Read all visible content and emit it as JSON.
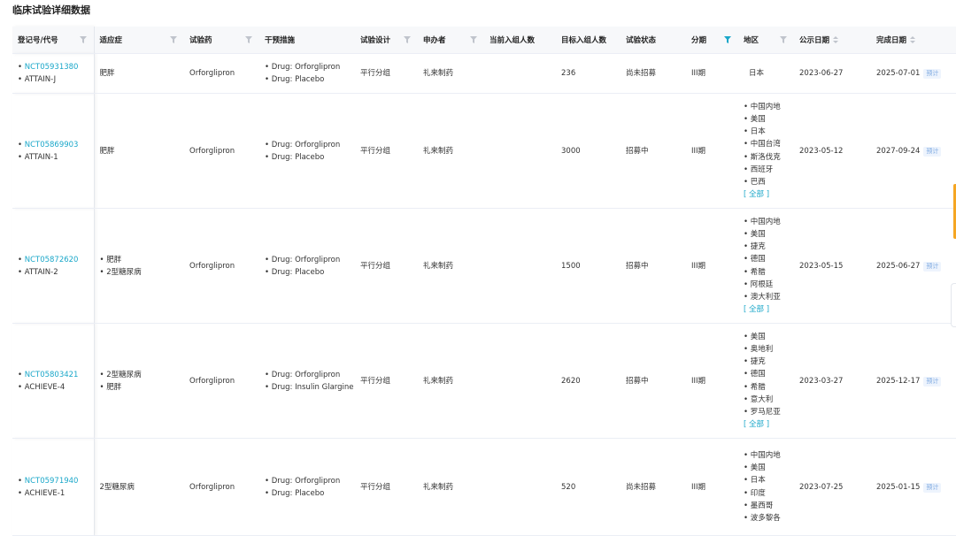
{
  "page": {
    "title": "临床试验详细数据"
  },
  "colors": {
    "link": "#1aa7c9",
    "filter_inactive": "#c0c4cc",
    "filter_active": "#1aa7c9",
    "tag_text": "#7aa7e0",
    "tag_bg": "#eef4fd",
    "side_tab": "#f5a623"
  },
  "table": {
    "columns": {
      "reg_id": "登记号/代号",
      "indication": "适应症",
      "drug": "试验药",
      "intervention": "干预措施",
      "design": "试验设计",
      "sponsor": "申办者",
      "current_enroll": "当前入组人数",
      "target_enroll": "目标入组人数",
      "status": "试验状态",
      "phase": "分期",
      "region": "地区",
      "pub_date": "公示日期",
      "complete_date": "完成日期"
    },
    "rows": [
      {
        "nct": "NCT05931380",
        "code": "ATTAIN-J",
        "indication1": "肥胖",
        "indication2": "",
        "drug": "Orforglipron",
        "intervention1": "Drug: Orforglipron",
        "intervention2": "Drug: Placebo",
        "design": "平行分组",
        "sponsor": "礼来制药",
        "current_enroll": "",
        "target_enroll": "236",
        "status": "尚未招募",
        "phase": "III期",
        "regions": [
          "日本"
        ],
        "show_all": "",
        "pub_date": "2023-06-27",
        "complete_date": "2025-07-01",
        "complete_tag": "预计"
      },
      {
        "nct": "NCT05869903",
        "code": "ATTAIN-1",
        "indication1": "肥胖",
        "indication2": "",
        "drug": "Orforglipron",
        "intervention1": "Drug: Orforglipron",
        "intervention2": "Drug: Placebo",
        "design": "平行分组",
        "sponsor": "礼来制药",
        "current_enroll": "",
        "target_enroll": "3000",
        "status": "招募中",
        "phase": "III期",
        "regions": [
          "中国内地",
          "美国",
          "日本",
          "中国台湾",
          "斯洛伐克",
          "西班牙",
          "巴西"
        ],
        "show_all": "[ 全部 ]",
        "pub_date": "2023-05-12",
        "complete_date": "2027-09-24",
        "complete_tag": "预计"
      },
      {
        "nct": "NCT05872620",
        "code": "ATTAIN-2",
        "indication1": "肥胖",
        "indication2": "2型糖尿病",
        "drug": "Orforglipron",
        "intervention1": "Drug: Orforglipron",
        "intervention2": "Drug: Placebo",
        "design": "平行分组",
        "sponsor": "礼来制药",
        "current_enroll": "",
        "target_enroll": "1500",
        "status": "招募中",
        "phase": "III期",
        "regions": [
          "中国内地",
          "美国",
          "捷克",
          "德国",
          "希腊",
          "阿根廷",
          "澳大利亚"
        ],
        "show_all": "[ 全部 ]",
        "pub_date": "2023-05-15",
        "complete_date": "2025-06-27",
        "complete_tag": "预计"
      },
      {
        "nct": "NCT05803421",
        "code": "ACHIEVE-4",
        "indication1": "2型糖尿病",
        "indication2": "肥胖",
        "drug": "Orforglipron",
        "intervention1": "Drug: Orforglipron",
        "intervention2": "Drug: Insulin Glargine",
        "design": "平行分组",
        "sponsor": "礼来制药",
        "current_enroll": "",
        "target_enroll": "2620",
        "status": "招募中",
        "phase": "III期",
        "regions": [
          "美国",
          "奥地利",
          "捷克",
          "德国",
          "希腊",
          "意大利",
          "罗马尼亚"
        ],
        "show_all": "[ 全部 ]",
        "pub_date": "2023-03-27",
        "complete_date": "2025-12-17",
        "complete_tag": "预计"
      },
      {
        "nct": "NCT05971940",
        "code": "ACHIEVE-1",
        "indication1": "2型糖尿病",
        "indication2": "",
        "drug": "Orforglipron",
        "intervention1": "Drug: Orforglipron",
        "intervention2": "Drug: Placebo",
        "design": "平行分组",
        "sponsor": "礼来制药",
        "current_enroll": "",
        "target_enroll": "520",
        "status": "尚未招募",
        "phase": "III期",
        "regions": [
          "中国内地",
          "美国",
          "日本",
          "印度",
          "墨西哥",
          "波多黎各"
        ],
        "show_all": "",
        "pub_date": "2023-07-25",
        "complete_date": "2025-01-15",
        "complete_tag": "预计"
      }
    ]
  }
}
